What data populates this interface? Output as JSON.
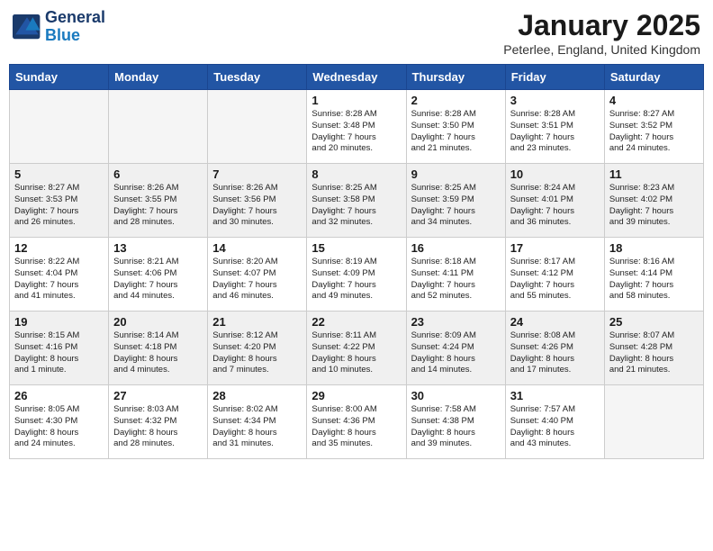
{
  "header": {
    "logo_line1": "General",
    "logo_line2": "Blue",
    "month": "January 2025",
    "location": "Peterlee, England, United Kingdom"
  },
  "weekdays": [
    "Sunday",
    "Monday",
    "Tuesday",
    "Wednesday",
    "Thursday",
    "Friday",
    "Saturday"
  ],
  "weeks": [
    [
      {
        "day": "",
        "info": ""
      },
      {
        "day": "",
        "info": ""
      },
      {
        "day": "",
        "info": ""
      },
      {
        "day": "1",
        "info": "Sunrise: 8:28 AM\nSunset: 3:48 PM\nDaylight: 7 hours\nand 20 minutes."
      },
      {
        "day": "2",
        "info": "Sunrise: 8:28 AM\nSunset: 3:50 PM\nDaylight: 7 hours\nand 21 minutes."
      },
      {
        "day": "3",
        "info": "Sunrise: 8:28 AM\nSunset: 3:51 PM\nDaylight: 7 hours\nand 23 minutes."
      },
      {
        "day": "4",
        "info": "Sunrise: 8:27 AM\nSunset: 3:52 PM\nDaylight: 7 hours\nand 24 minutes."
      }
    ],
    [
      {
        "day": "5",
        "info": "Sunrise: 8:27 AM\nSunset: 3:53 PM\nDaylight: 7 hours\nand 26 minutes."
      },
      {
        "day": "6",
        "info": "Sunrise: 8:26 AM\nSunset: 3:55 PM\nDaylight: 7 hours\nand 28 minutes."
      },
      {
        "day": "7",
        "info": "Sunrise: 8:26 AM\nSunset: 3:56 PM\nDaylight: 7 hours\nand 30 minutes."
      },
      {
        "day": "8",
        "info": "Sunrise: 8:25 AM\nSunset: 3:58 PM\nDaylight: 7 hours\nand 32 minutes."
      },
      {
        "day": "9",
        "info": "Sunrise: 8:25 AM\nSunset: 3:59 PM\nDaylight: 7 hours\nand 34 minutes."
      },
      {
        "day": "10",
        "info": "Sunrise: 8:24 AM\nSunset: 4:01 PM\nDaylight: 7 hours\nand 36 minutes."
      },
      {
        "day": "11",
        "info": "Sunrise: 8:23 AM\nSunset: 4:02 PM\nDaylight: 7 hours\nand 39 minutes."
      }
    ],
    [
      {
        "day": "12",
        "info": "Sunrise: 8:22 AM\nSunset: 4:04 PM\nDaylight: 7 hours\nand 41 minutes."
      },
      {
        "day": "13",
        "info": "Sunrise: 8:21 AM\nSunset: 4:06 PM\nDaylight: 7 hours\nand 44 minutes."
      },
      {
        "day": "14",
        "info": "Sunrise: 8:20 AM\nSunset: 4:07 PM\nDaylight: 7 hours\nand 46 minutes."
      },
      {
        "day": "15",
        "info": "Sunrise: 8:19 AM\nSunset: 4:09 PM\nDaylight: 7 hours\nand 49 minutes."
      },
      {
        "day": "16",
        "info": "Sunrise: 8:18 AM\nSunset: 4:11 PM\nDaylight: 7 hours\nand 52 minutes."
      },
      {
        "day": "17",
        "info": "Sunrise: 8:17 AM\nSunset: 4:12 PM\nDaylight: 7 hours\nand 55 minutes."
      },
      {
        "day": "18",
        "info": "Sunrise: 8:16 AM\nSunset: 4:14 PM\nDaylight: 7 hours\nand 58 minutes."
      }
    ],
    [
      {
        "day": "19",
        "info": "Sunrise: 8:15 AM\nSunset: 4:16 PM\nDaylight: 8 hours\nand 1 minute."
      },
      {
        "day": "20",
        "info": "Sunrise: 8:14 AM\nSunset: 4:18 PM\nDaylight: 8 hours\nand 4 minutes."
      },
      {
        "day": "21",
        "info": "Sunrise: 8:12 AM\nSunset: 4:20 PM\nDaylight: 8 hours\nand 7 minutes."
      },
      {
        "day": "22",
        "info": "Sunrise: 8:11 AM\nSunset: 4:22 PM\nDaylight: 8 hours\nand 10 minutes."
      },
      {
        "day": "23",
        "info": "Sunrise: 8:09 AM\nSunset: 4:24 PM\nDaylight: 8 hours\nand 14 minutes."
      },
      {
        "day": "24",
        "info": "Sunrise: 8:08 AM\nSunset: 4:26 PM\nDaylight: 8 hours\nand 17 minutes."
      },
      {
        "day": "25",
        "info": "Sunrise: 8:07 AM\nSunset: 4:28 PM\nDaylight: 8 hours\nand 21 minutes."
      }
    ],
    [
      {
        "day": "26",
        "info": "Sunrise: 8:05 AM\nSunset: 4:30 PM\nDaylight: 8 hours\nand 24 minutes."
      },
      {
        "day": "27",
        "info": "Sunrise: 8:03 AM\nSunset: 4:32 PM\nDaylight: 8 hours\nand 28 minutes."
      },
      {
        "day": "28",
        "info": "Sunrise: 8:02 AM\nSunset: 4:34 PM\nDaylight: 8 hours\nand 31 minutes."
      },
      {
        "day": "29",
        "info": "Sunrise: 8:00 AM\nSunset: 4:36 PM\nDaylight: 8 hours\nand 35 minutes."
      },
      {
        "day": "30",
        "info": "Sunrise: 7:58 AM\nSunset: 4:38 PM\nDaylight: 8 hours\nand 39 minutes."
      },
      {
        "day": "31",
        "info": "Sunrise: 7:57 AM\nSunset: 4:40 PM\nDaylight: 8 hours\nand 43 minutes."
      },
      {
        "day": "",
        "info": ""
      }
    ]
  ]
}
